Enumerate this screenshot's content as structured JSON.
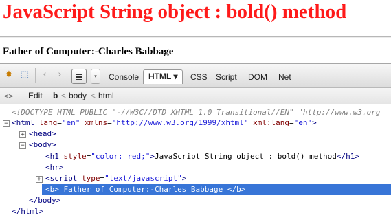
{
  "page": {
    "heading": "JavaScript String object : bold() method",
    "bold_text": "Father of Computer:-Charles Babbage"
  },
  "firebug": {
    "toolbar": {
      "tabs": [
        "Console",
        "HTML",
        "CSS",
        "Script",
        "DOM",
        "Net"
      ],
      "active_tab": "HTML",
      "dropdown_glyph": "▾"
    },
    "breadcrumb": {
      "edit_label": "Edit",
      "items": [
        "b",
        "body",
        "html"
      ],
      "separator": "<"
    },
    "html_tree": {
      "doctype": "<!DOCTYPE HTML PUBLIC \"-//W3C//DTD XHTML 1.0 Transitional//EN\" \"http://www.w3.org",
      "html_open": {
        "tag": "html",
        "attrs": [
          [
            "lang",
            "en"
          ],
          [
            "xmlns",
            "http://www.w3.org/1999/xhtml"
          ],
          [
            "xml:lang",
            "en"
          ]
        ]
      },
      "head": "head",
      "body": "body",
      "h1": {
        "attr": "style",
        "value": "color: red;",
        "text": "JavaScript String object : bold() method"
      },
      "hr": "hr",
      "script": {
        "attr": "type",
        "value": "text/javascript"
      },
      "b_text": "Father of Computer:-Charles Babbage",
      "body_close": "</body>",
      "html_close": "</html>"
    }
  },
  "colors": {
    "heading": "#ff1a1a",
    "selection": "#3875d7"
  }
}
